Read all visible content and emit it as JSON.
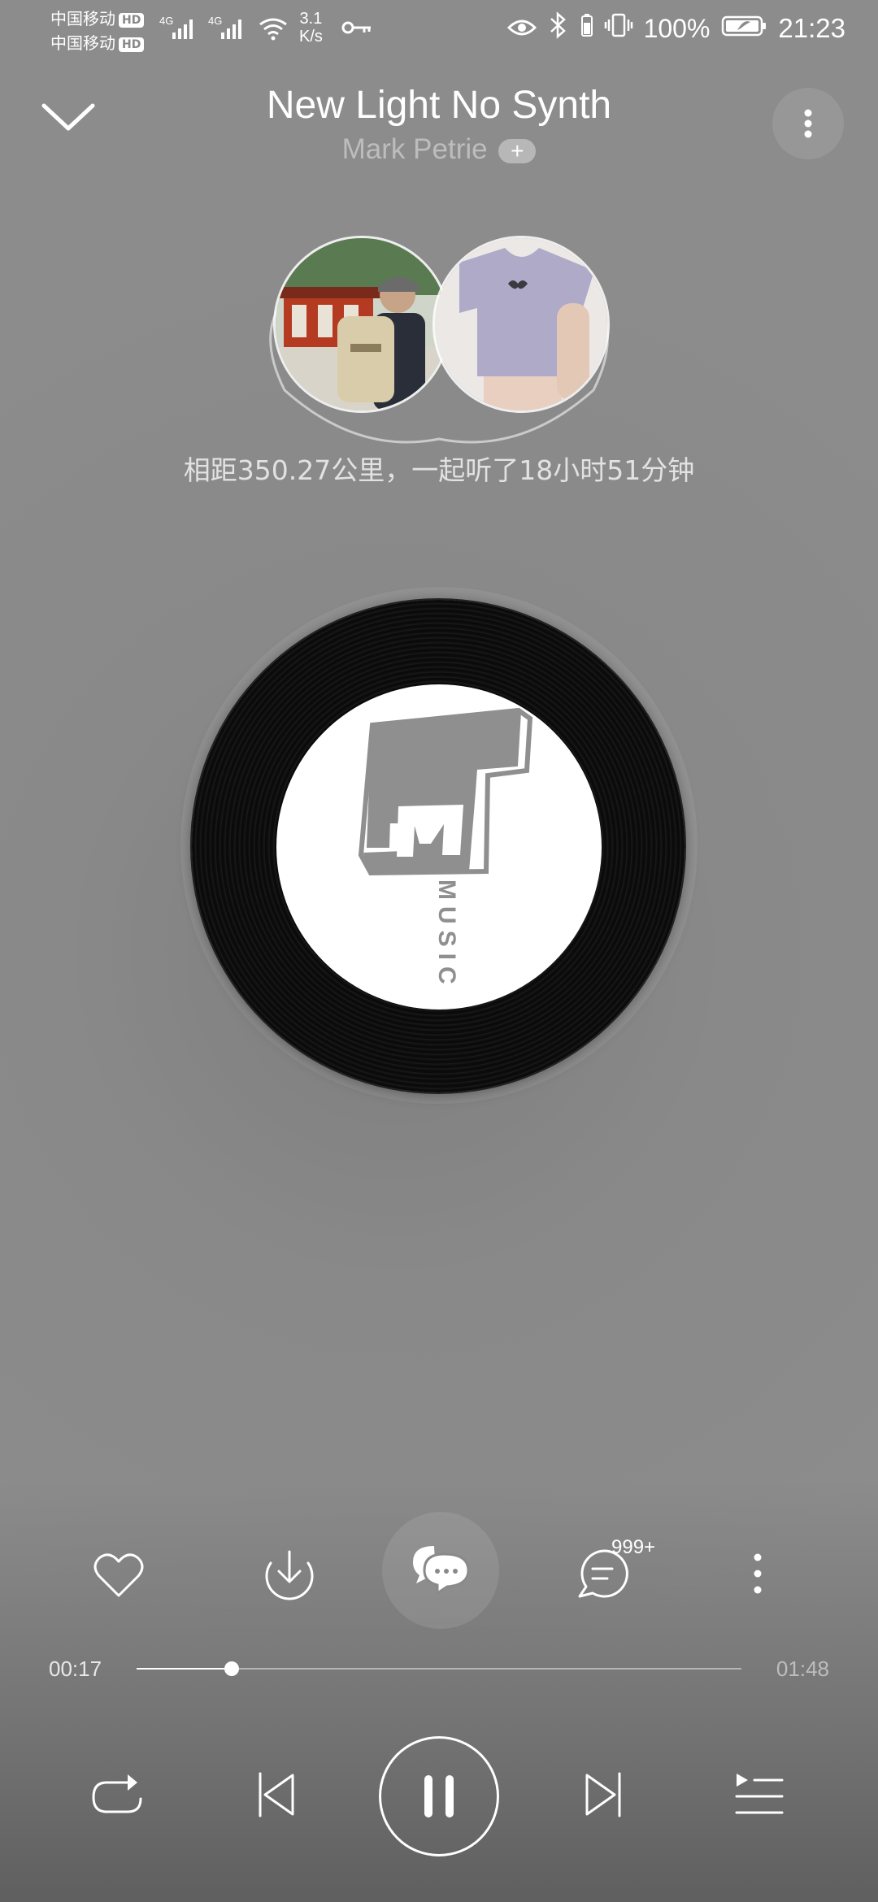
{
  "status_bar": {
    "carrier1": "中国移动",
    "carrier2": "中国移动",
    "hd": "HD",
    "network1": "4G",
    "network2": "4G",
    "speed_value": "3.1",
    "speed_unit": "K/s",
    "battery": "100%",
    "time": "21:23",
    "icons": [
      "signal-icon",
      "wifi-icon",
      "vpn-key-icon",
      "eye-icon",
      "bluetooth-icon",
      "vibrate-icon",
      "battery-icon"
    ]
  },
  "header": {
    "title": "New Light No Synth",
    "artist": "Mark Petrie",
    "follow_label": "+"
  },
  "listen_together": {
    "text": "相距350.27公里，一起听了18小时51分钟"
  },
  "album": {
    "label_text": "MUSIC"
  },
  "actions": {
    "comment_count": "999+"
  },
  "progress": {
    "current": "00:17",
    "total": "01:48",
    "fraction": 0.157
  },
  "colors": {
    "background": "#8a8a8a",
    "foreground": "#ffffff"
  }
}
